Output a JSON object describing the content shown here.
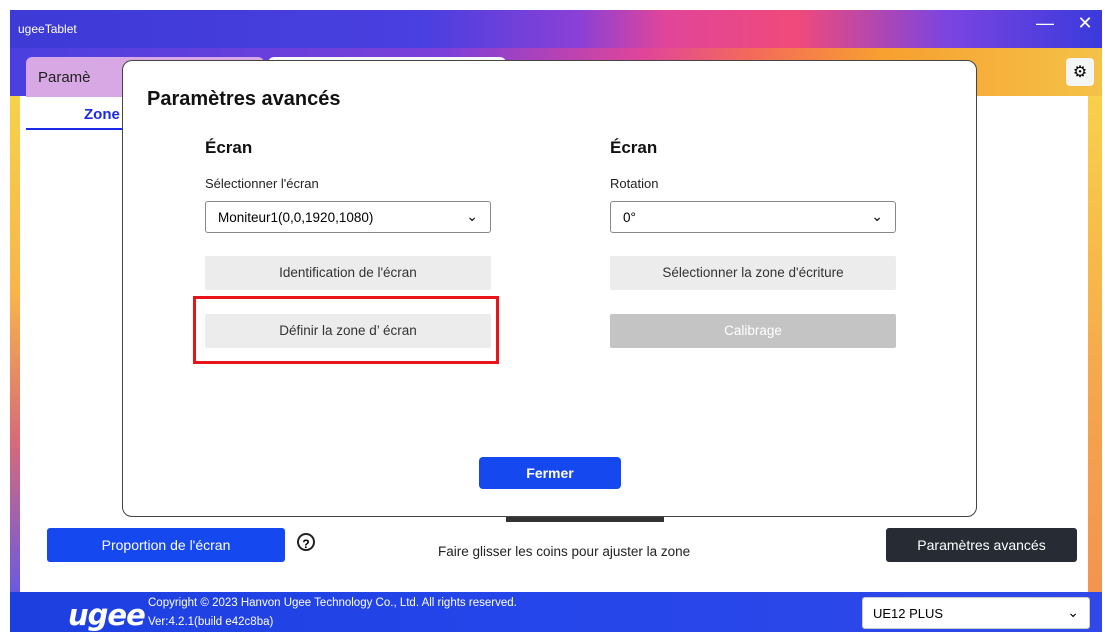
{
  "window": {
    "title": "ugeeTablet",
    "minimize_icon": "minimize-icon",
    "close_icon": "close-icon"
  },
  "tabs": [
    {
      "label": "Paramè"
    },
    {
      "label": ""
    }
  ],
  "subtab": {
    "label": "Zone"
  },
  "dialog": {
    "title": "Paramètres avancés",
    "left": {
      "heading": "Écran",
      "select_label": "Sélectionner l'écran",
      "select_value": "Moniteur1(0,0,1920,1080)",
      "btn_identify": "Identification de l'écran",
      "btn_define": "Définir la zone d’ écran"
    },
    "right": {
      "heading": "Écran",
      "select_label": "Rotation",
      "select_value": "0°",
      "btn_select_zone": "Sélectionner la zone d'écriture",
      "btn_calibrate": "Calibrage"
    },
    "close_label": "Fermer"
  },
  "bottom": {
    "proportion_label": "Proportion de l'écran",
    "help_glyph": "?",
    "hint": "Faire glisser les coins pour ajuster la zone",
    "advanced_label": "Paramètres avancés"
  },
  "footer": {
    "logo": "ugee",
    "copyright": "Copyright © 2023 Hanvon Ugee Technology Co., Ltd. All rights reserved.",
    "version": "Ver:4.2.1(build e42c8ba)",
    "device": "UE12 PLUS"
  },
  "colors": {
    "accent": "#1648f0",
    "highlight": "#e8141a",
    "dark_button": "#262b34"
  }
}
